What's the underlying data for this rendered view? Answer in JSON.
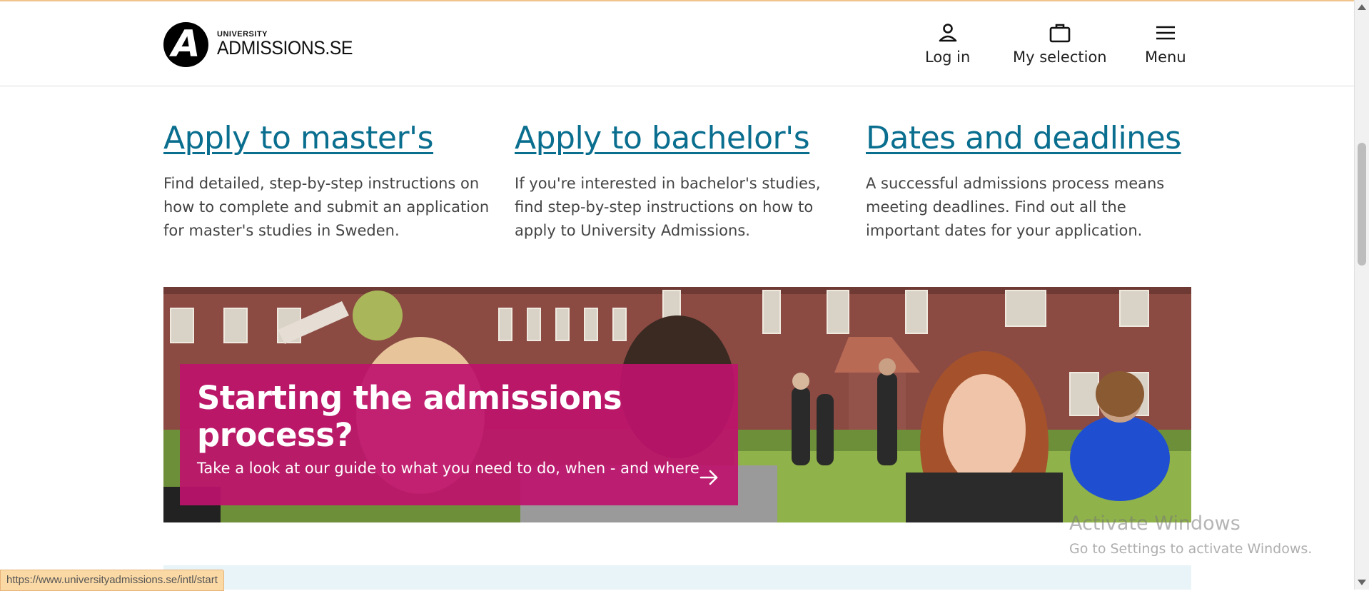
{
  "header": {
    "logo_mark": "A",
    "logo_small": "UNIVERSITY",
    "logo_big": "ADMISSIONS.SE",
    "login_label": "Log in",
    "selection_label": "My selection",
    "menu_label": "Menu"
  },
  "columns": [
    {
      "title": "Apply to master's",
      "text": "Find detailed, step-by-step instructions on how to complete and submit an application for master's studies in Sweden."
    },
    {
      "title": "Apply to bachelor's",
      "text": "If you're interested in bachelor's studies, find step-by-step instructions on how to apply to University Admissions."
    },
    {
      "title": "Dates and deadlines",
      "text": "A successful admissions process means meeting deadlines. Find out all the important dates for your application."
    }
  ],
  "hero": {
    "title": "Starting the admissions process?",
    "subtitle": "Take a look at our guide to what you need to do, when - and where"
  },
  "status_bar": {
    "url": "https://www.universityadmissions.se/intl/start"
  },
  "watermark": {
    "line1": "Activate Windows",
    "line2": "Go to Settings to activate Windows."
  },
  "colors": {
    "link": "#0a6e8f",
    "hero_card": "#be126c",
    "info_band": "#e8f4f7"
  },
  "icons": [
    "user-icon",
    "briefcase-icon",
    "hamburger-icon",
    "arrow-right-icon"
  ]
}
